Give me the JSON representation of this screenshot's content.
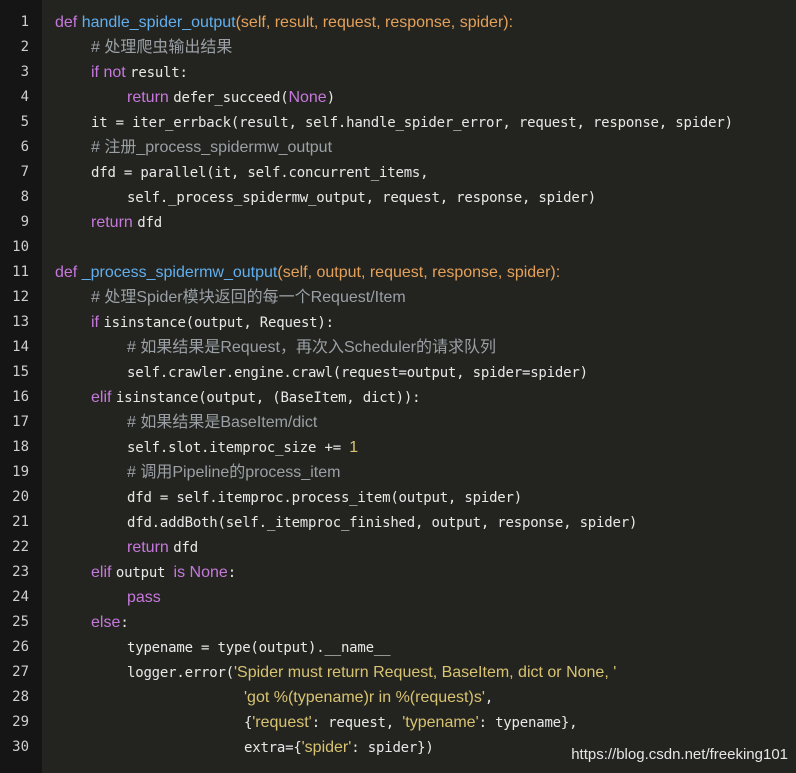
{
  "colors": {
    "background": "#23241f",
    "gutter": "#151515",
    "line_number": "#cfcfcf",
    "keyword": "#c678dd",
    "function_name": "#61afef",
    "param": "#e5a15a",
    "comment": "#9aa0a6",
    "string": "#d8c373",
    "number": "#d8c373",
    "constant": "#c678dd",
    "plain": "#e8e8e8"
  },
  "watermark": "https://blog.csdn.net/freeking101",
  "lines": [
    {
      "n": "1",
      "indent": 0,
      "tokens": [
        {
          "t": "def ",
          "c": "keyword",
          "f": "sans"
        },
        {
          "t": "handle_spider_output",
          "c": "function_name",
          "f": "sans"
        },
        {
          "t": "(self, result, request, response, spider):",
          "c": "param",
          "f": "sans"
        }
      ]
    },
    {
      "n": "2",
      "indent": 1,
      "tokens": [
        {
          "t": "# 处理爬虫输出结果",
          "c": "comment",
          "f": "sans"
        }
      ]
    },
    {
      "n": "3",
      "indent": 1,
      "tokens": [
        {
          "t": "if ",
          "c": "keyword",
          "f": "sans"
        },
        {
          "t": "not ",
          "c": "keyword",
          "f": "sans"
        },
        {
          "t": "result:",
          "c": "plain",
          "f": "mono"
        }
      ]
    },
    {
      "n": "4",
      "indent": 2,
      "tokens": [
        {
          "t": "return ",
          "c": "keyword",
          "f": "sans"
        },
        {
          "t": "defer_succeed(",
          "c": "plain",
          "f": "mono"
        },
        {
          "t": "None",
          "c": "constant",
          "f": "sans"
        },
        {
          "t": ")",
          "c": "plain",
          "f": "mono"
        }
      ]
    },
    {
      "n": "5",
      "indent": 1,
      "tokens": [
        {
          "t": "it = iter_errback(result, self.handle_spider_error, request, response, spider)",
          "c": "plain",
          "f": "mono"
        }
      ]
    },
    {
      "n": "6",
      "indent": 1,
      "tokens": [
        {
          "t": "# 注册_process_spidermw_output",
          "c": "comment",
          "f": "sans"
        }
      ]
    },
    {
      "n": "7",
      "indent": 1,
      "tokens": [
        {
          "t": "dfd = parallel(it, self.concurrent_items,",
          "c": "plain",
          "f": "mono"
        }
      ]
    },
    {
      "n": "8",
      "indent": 2,
      "tokens": [
        {
          "t": "self._process_spidermw_output, request, response, spider)",
          "c": "plain",
          "f": "mono"
        }
      ]
    },
    {
      "n": "9",
      "indent": 1,
      "tokens": [
        {
          "t": "return ",
          "c": "keyword",
          "f": "sans"
        },
        {
          "t": "dfd",
          "c": "plain",
          "f": "mono"
        }
      ]
    },
    {
      "n": "10",
      "indent": 0,
      "tokens": []
    },
    {
      "n": "11",
      "indent": 0,
      "tokens": [
        {
          "t": "def ",
          "c": "keyword",
          "f": "sans"
        },
        {
          "t": "_process_spidermw_output",
          "c": "function_name",
          "f": "sans"
        },
        {
          "t": "(self, output, request, response, spider):",
          "c": "param",
          "f": "sans"
        }
      ]
    },
    {
      "n": "12",
      "indent": 1,
      "tokens": [
        {
          "t": "# 处理Spider模块返回的每一个Request/Item",
          "c": "comment",
          "f": "sans"
        }
      ]
    },
    {
      "n": "13",
      "indent": 1,
      "tokens": [
        {
          "t": "if ",
          "c": "keyword",
          "f": "sans"
        },
        {
          "t": "isinstance(output, Request):",
          "c": "plain",
          "f": "mono"
        }
      ]
    },
    {
      "n": "14",
      "indent": 2,
      "tokens": [
        {
          "t": "# 如果结果是Request，再次入Scheduler的请求队列",
          "c": "comment",
          "f": "sans"
        }
      ]
    },
    {
      "n": "15",
      "indent": 2,
      "tokens": [
        {
          "t": "self.crawler.engine.crawl(request=output, spider=spider)",
          "c": "plain",
          "f": "mono"
        }
      ]
    },
    {
      "n": "16",
      "indent": 1,
      "tokens": [
        {
          "t": "elif ",
          "c": "keyword",
          "f": "sans"
        },
        {
          "t": "isinstance(output, (BaseItem, dict)):",
          "c": "plain",
          "f": "mono"
        }
      ]
    },
    {
      "n": "17",
      "indent": 2,
      "tokens": [
        {
          "t": "# 如果结果是BaseItem/dict",
          "c": "comment",
          "f": "sans"
        }
      ]
    },
    {
      "n": "18",
      "indent": 2,
      "tokens": [
        {
          "t": "self.slot.itemproc_size += ",
          "c": "plain",
          "f": "mono"
        },
        {
          "t": "1",
          "c": "number",
          "f": "sans"
        }
      ]
    },
    {
      "n": "19",
      "indent": 2,
      "tokens": [
        {
          "t": "# 调用Pipeline的process_item",
          "c": "comment",
          "f": "sans"
        }
      ]
    },
    {
      "n": "20",
      "indent": 2,
      "tokens": [
        {
          "t": "dfd = self.itemproc.process_item(output, spider)",
          "c": "plain",
          "f": "mono"
        }
      ]
    },
    {
      "n": "21",
      "indent": 2,
      "tokens": [
        {
          "t": "dfd.addBoth(self._itemproc_finished, output, response, spider)",
          "c": "plain",
          "f": "mono"
        }
      ]
    },
    {
      "n": "22",
      "indent": 2,
      "tokens": [
        {
          "t": "return ",
          "c": "keyword",
          "f": "sans"
        },
        {
          "t": "dfd",
          "c": "plain",
          "f": "mono"
        }
      ]
    },
    {
      "n": "23",
      "indent": 1,
      "tokens": [
        {
          "t": "elif ",
          "c": "keyword",
          "f": "sans"
        },
        {
          "t": "output ",
          "c": "plain",
          "f": "mono"
        },
        {
          "t": "is ",
          "c": "keyword",
          "f": "sans"
        },
        {
          "t": "None",
          "c": "constant",
          "f": "sans"
        },
        {
          "t": ":",
          "c": "plain",
          "f": "mono"
        }
      ]
    },
    {
      "n": "24",
      "indent": 2,
      "tokens": [
        {
          "t": "pass",
          "c": "keyword",
          "f": "sans"
        }
      ]
    },
    {
      "n": "25",
      "indent": 1,
      "tokens": [
        {
          "t": "else",
          "c": "keyword",
          "f": "sans"
        },
        {
          "t": ":",
          "c": "plain",
          "f": "mono"
        }
      ]
    },
    {
      "n": "26",
      "indent": 2,
      "tokens": [
        {
          "t": "typename = type(output).__name__",
          "c": "plain",
          "f": "mono"
        }
      ]
    },
    {
      "n": "27",
      "indent": 2,
      "tokens": [
        {
          "t": "logger.error(",
          "c": "plain",
          "f": "mono"
        },
        {
          "t": "'Spider must return Request, BaseItem, dict or None, '",
          "c": "string",
          "f": "sans"
        }
      ]
    },
    {
      "n": "28",
      "indent": 5.25,
      "tokens": [
        {
          "t": "'got %(typename)r in %(request)s'",
          "c": "string",
          "f": "sans"
        },
        {
          "t": ",",
          "c": "plain",
          "f": "mono"
        }
      ]
    },
    {
      "n": "29",
      "indent": 5.25,
      "tokens": [
        {
          "t": "{",
          "c": "plain",
          "f": "mono"
        },
        {
          "t": "'request'",
          "c": "string",
          "f": "sans"
        },
        {
          "t": ": request, ",
          "c": "plain",
          "f": "mono"
        },
        {
          "t": "'typename'",
          "c": "string",
          "f": "sans"
        },
        {
          "t": ": typename},",
          "c": "plain",
          "f": "mono"
        }
      ]
    },
    {
      "n": "30",
      "indent": 5.25,
      "tokens": [
        {
          "t": "extra={",
          "c": "plain",
          "f": "mono"
        },
        {
          "t": "'spider'",
          "c": "string",
          "f": "sans"
        },
        {
          "t": ": spider})",
          "c": "plain",
          "f": "mono"
        }
      ]
    }
  ]
}
